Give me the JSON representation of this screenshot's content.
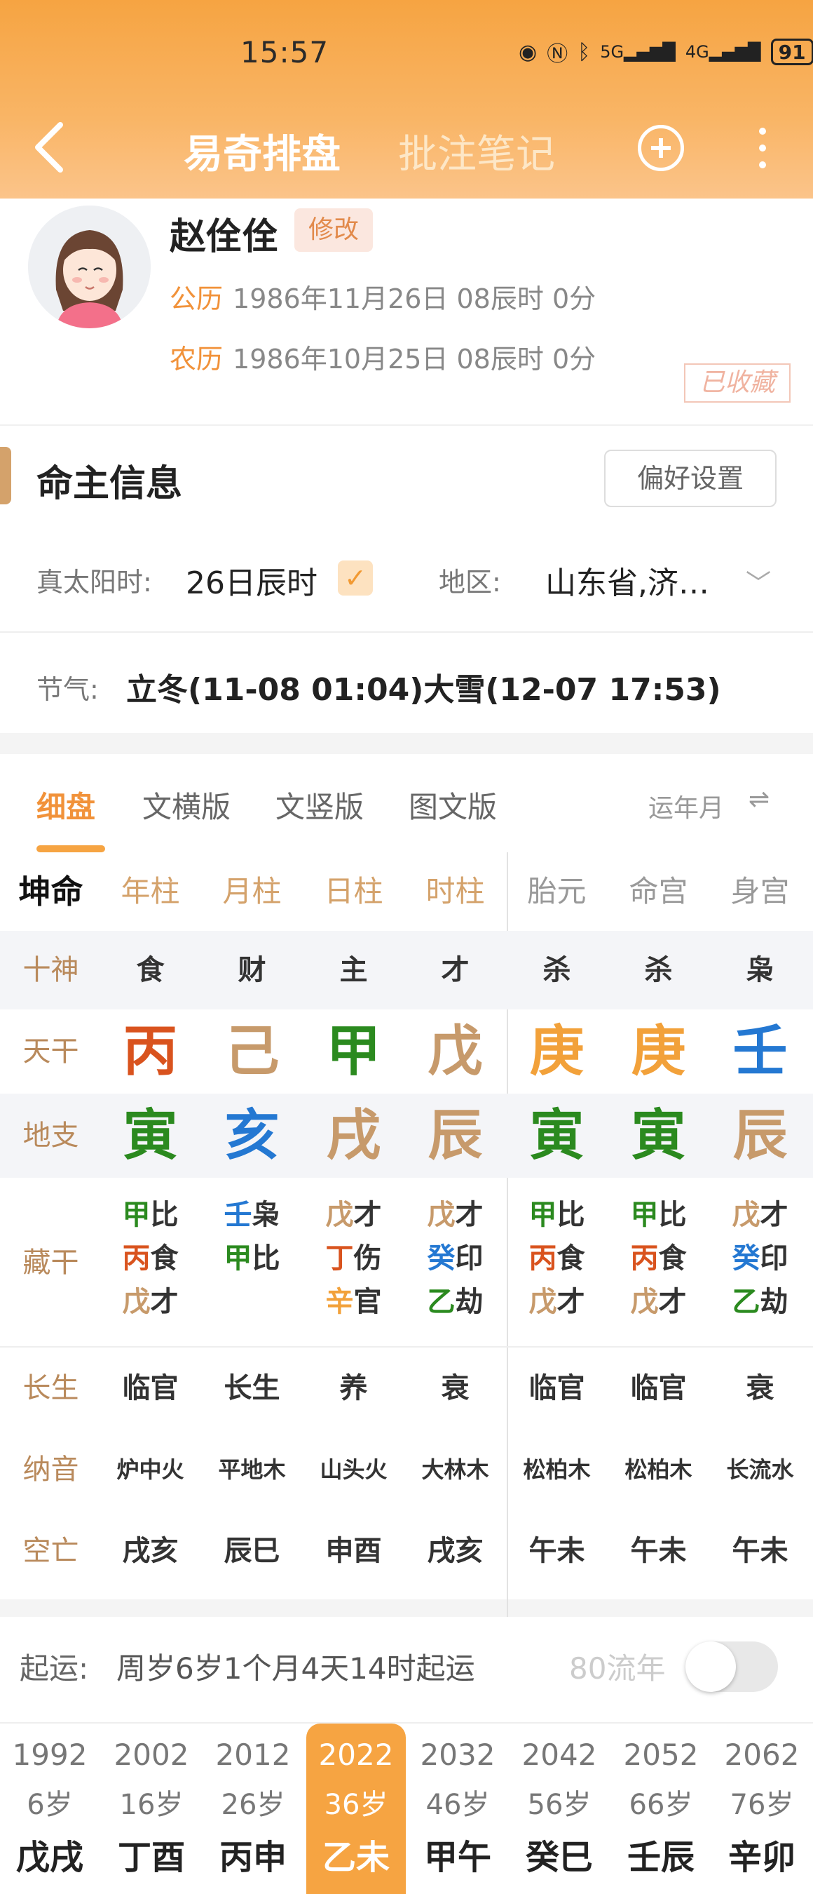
{
  "status": {
    "time": "15:57",
    "battery": "91"
  },
  "nav": {
    "active_tab": "易奇排盘",
    "other_tab": "批注笔记"
  },
  "profile": {
    "name": "赵佺佺",
    "edit_label": "修改",
    "solar_label": "公历",
    "solar_date": "1986年11月26日 08辰时 0分",
    "lunar_label": "农历",
    "lunar_date": "1986年10月25日 08辰时 0分",
    "fav_label": "已收藏"
  },
  "info": {
    "title": "命主信息",
    "pref_button": "偏好设置",
    "solar_time_label": "真太阳时:",
    "solar_time_value": "26日辰时",
    "region_label": "地区:",
    "region_value": "山东省,济…",
    "jieqi_label": "节气:",
    "jieqi_value": "立冬(11-08 01:04)大雪(12-07 17:53)"
  },
  "chart_tabs": [
    "细盘",
    "文横版",
    "文竖版",
    "图文版"
  ],
  "yun_label": "运年月",
  "columns": [
    "坤命",
    "年柱",
    "月柱",
    "日柱",
    "时柱",
    "胎元",
    "命宫",
    "身宫"
  ],
  "rows": {
    "shishen": {
      "label": "十神",
      "values": [
        "食",
        "财",
        "主",
        "才",
        "杀",
        "杀",
        "枭"
      ]
    },
    "tiangan": {
      "label": "天干",
      "values": [
        "丙",
        "己",
        "甲",
        "戊",
        "庚",
        "庚",
        "壬"
      ]
    },
    "dizhi": {
      "label": "地支",
      "values": [
        "寅",
        "亥",
        "戌",
        "辰",
        "寅",
        "寅",
        "辰"
      ]
    },
    "canggan": {
      "label": "藏干",
      "values": [
        [
          [
            "甲",
            "比"
          ],
          [
            "丙",
            "食"
          ],
          [
            "戊",
            "才"
          ]
        ],
        [
          [
            "壬",
            "枭"
          ],
          [
            "甲",
            "比"
          ]
        ],
        [
          [
            "戊",
            "才"
          ],
          [
            "丁",
            "伤"
          ],
          [
            "辛",
            "官"
          ]
        ],
        [
          [
            "戊",
            "才"
          ],
          [
            "癸",
            "印"
          ],
          [
            "乙",
            "劫"
          ]
        ],
        [
          [
            "甲",
            "比"
          ],
          [
            "丙",
            "食"
          ],
          [
            "戊",
            "才"
          ]
        ],
        [
          [
            "甲",
            "比"
          ],
          [
            "丙",
            "食"
          ],
          [
            "戊",
            "才"
          ]
        ],
        [
          [
            "戊",
            "才"
          ],
          [
            "癸",
            "印"
          ],
          [
            "乙",
            "劫"
          ]
        ]
      ]
    },
    "changsheng": {
      "label": "长生",
      "values": [
        "临官",
        "长生",
        "养",
        "衰",
        "临官",
        "临官",
        "衰"
      ]
    },
    "nayin": {
      "label": "纳音",
      "values": [
        "炉中火",
        "平地木",
        "山头火",
        "大林木",
        "松柏木",
        "松柏木",
        "长流水"
      ]
    },
    "kongwang": {
      "label": "空亡",
      "values": [
        "戌亥",
        "辰巳",
        "申酉",
        "戌亥",
        "午未",
        "午未",
        "午未"
      ]
    }
  },
  "colors": {
    "fire": "#d9531e",
    "earth": "#c79a6b",
    "wood": "#2b8a1f",
    "water": "#2478d2",
    "metal": "#f2a13a"
  },
  "qiyun": {
    "label": "起运:",
    "value": "周岁6岁1个月4天14时起运",
    "liunian_label": "80流年"
  },
  "dayun": [
    {
      "year": "1992",
      "age": "6岁",
      "gz": "戊戌"
    },
    {
      "year": "2002",
      "age": "16岁",
      "gz": "丁酉"
    },
    {
      "year": "2012",
      "age": "26岁",
      "gz": "丙申"
    },
    {
      "year": "2022",
      "age": "36岁",
      "gz": "乙未",
      "active": true
    },
    {
      "year": "2032",
      "age": "46岁",
      "gz": "甲午"
    },
    {
      "year": "2042",
      "age": "56岁",
      "gz": "癸巳"
    },
    {
      "year": "2052",
      "age": "66岁",
      "gz": "壬辰"
    },
    {
      "year": "2062",
      "age": "76岁",
      "gz": "辛卯"
    }
  ]
}
